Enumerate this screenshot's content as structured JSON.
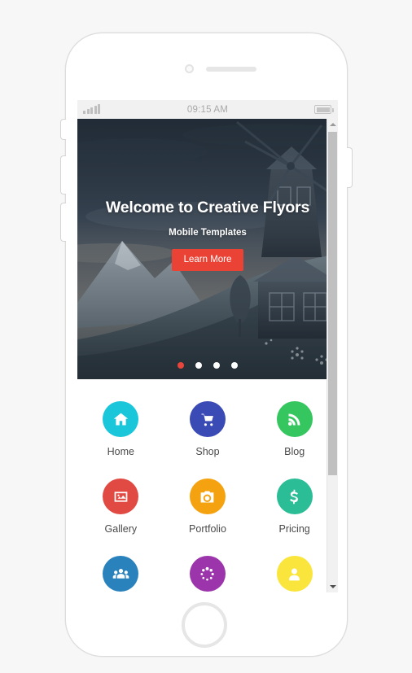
{
  "device": {
    "frame_label": "smartphone-mockup",
    "camera_icon": "camera-icon",
    "speaker_icon": "speaker-grill-icon",
    "home_button_label": "home-button",
    "buttons": [
      {
        "name": "silent-switch"
      },
      {
        "name": "volume-up-button"
      },
      {
        "name": "volume-down-button"
      },
      {
        "name": "power-button"
      }
    ]
  },
  "status_bar": {
    "signal_icon": "signal-bars-icon",
    "time": "09:15 AM",
    "battery_icon": "battery-full-icon"
  },
  "hero": {
    "title": "Welcome to Creative Flyors",
    "subtitle": "Mobile Templates",
    "cta_label": "Learn More",
    "cta_color": "#ea4335",
    "background_description": "windmill-on-hillside-at-dusk",
    "carousel": {
      "dot_count": 4,
      "active_index": 0,
      "active_color": "#e8453c",
      "inactive_color": "#ffffff"
    }
  },
  "grid": {
    "items": [
      {
        "label": "Home",
        "icon": "house-icon",
        "color": "#1ac6d9"
      },
      {
        "label": "Shop",
        "icon": "shopping-cart-icon",
        "color": "#3b4bb5"
      },
      {
        "label": "Blog",
        "icon": "rss-feed-icon",
        "color": "#35c660"
      },
      {
        "label": "Gallery",
        "icon": "image-icon",
        "color": "#e04a43"
      },
      {
        "label": "Portfolio",
        "icon": "camera-icon",
        "color": "#f5a210"
      },
      {
        "label": "Pricing",
        "icon": "dollar-sign-icon",
        "color": "#2bbd96"
      },
      {
        "label": "",
        "icon": "users-group-icon",
        "color": "#2a82bd"
      },
      {
        "label": "",
        "icon": "dots-loading-icon",
        "color": "#9c34ab"
      },
      {
        "label": "",
        "icon": "user-icon",
        "color": "#fae53c"
      }
    ]
  },
  "scrollbar": {
    "up_arrow": "scroll-up-arrow",
    "down_arrow": "scroll-down-arrow",
    "thumb": "scrollbar-thumb"
  }
}
